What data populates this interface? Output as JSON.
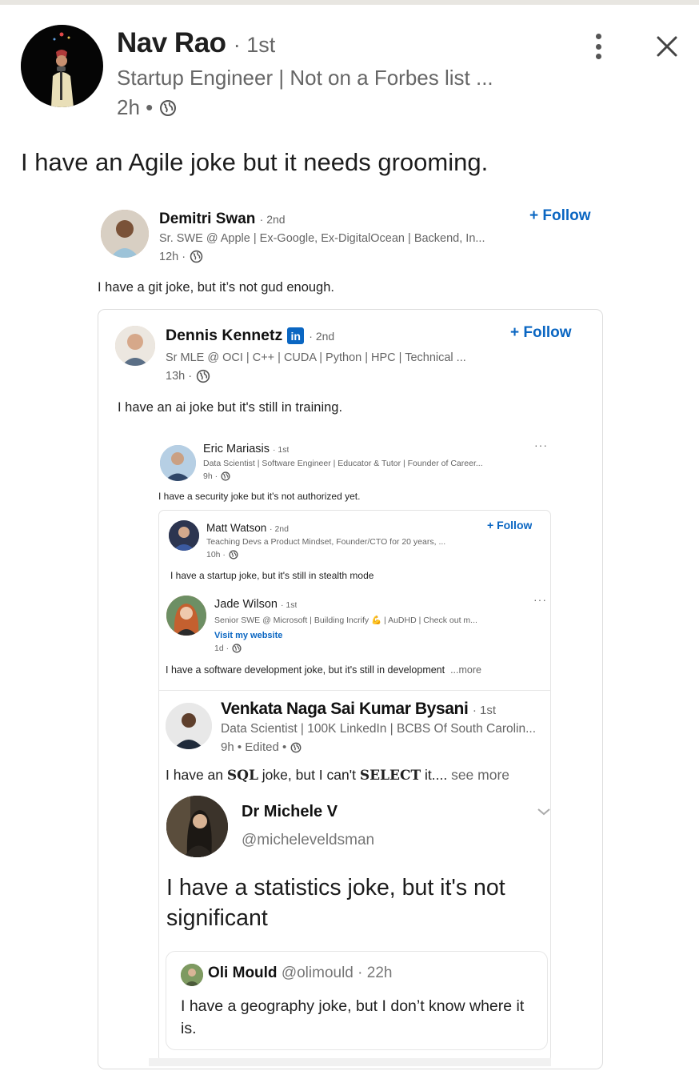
{
  "post": {
    "author_name": "Nav Rao",
    "author_degree": "· 1st",
    "author_headline": "Startup Engineer | Not on a Forbes list ...",
    "time": "2h •",
    "text": "I have an Agile joke but it needs grooming."
  },
  "icons": {
    "more": "more-vertical-icon",
    "close": "close-icon",
    "globe": "globe-icon",
    "linkedin": "linkedin-badge-icon",
    "chevron": "chevron-down-icon"
  },
  "colors": {
    "follow_blue": "#0a66c2",
    "secondary_text": "#666666"
  },
  "embedded": {
    "demitri": {
      "name": "Demitri Swan",
      "degree": "· 2nd",
      "headline": "Sr. SWE @ Apple | Ex-Google, Ex-DigitalOcean | Backend, In...",
      "time": "12h ·",
      "follow": "+ Follow",
      "text": "I have a git joke, but it’s not gud enough."
    },
    "dennis": {
      "name": "Dennis Kennetz",
      "badge": "in",
      "degree": "· 2nd",
      "headline": "Sr MLE @ OCI | C++ | CUDA | Python | HPC | Technical ...",
      "time": "13h ·",
      "follow": "+ Follow",
      "text": "I have an ai joke but it's still in training."
    },
    "eric": {
      "name": "Eric Mariasis",
      "degree": "· 1st",
      "headline": "Data Scientist | Software Engineer | Educator & Tutor | Founder of Career...",
      "time": "9h ·",
      "more": "···",
      "text": "I have a security joke but it's not authorized yet."
    },
    "matt": {
      "name": "Matt Watson",
      "degree": "· 2nd",
      "headline": "Teaching Devs a Product Mindset, Founder/CTO for 20 years, ...",
      "time": "10h ·",
      "follow": "+ Follow",
      "text": "I have a startup joke, but it's still in stealth mode"
    },
    "jade": {
      "name": "Jade Wilson",
      "degree": "· 1st",
      "headline": "Senior SWE @ Microsoft | Building Incrify 💪 | AuDHD | Check out m...",
      "link": "Visit my website",
      "time": "1d ·",
      "more": "···",
      "text": "I have a software development joke, but it's still in development",
      "see_more": "...more"
    },
    "venkata": {
      "name": "Venkata Naga Sai Kumar Bysani",
      "degree": "· 1st",
      "headline": "Data Scientist | 100K LinkedIn | BCBS Of South Carolin...",
      "time": "9h • Edited •",
      "text_before": "I have an ",
      "text_sql": "SQL",
      "text_middle": " joke, but I can't ",
      "text_select": "SELECT",
      "text_after": " it....",
      "see_more": " see more"
    },
    "michele": {
      "name": "Dr Michele V",
      "handle": "@micheleveldsman",
      "text": "I have a statistics joke, but it's not significant"
    },
    "oli": {
      "name": "Oli Mould",
      "handle": "@olimould · 22h",
      "text": "I have a geography joke, but I don’t know where it is."
    }
  }
}
